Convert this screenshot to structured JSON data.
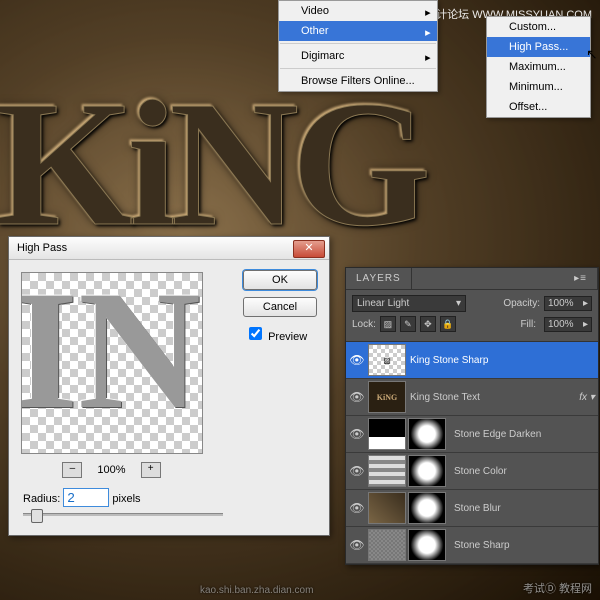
{
  "watermark_text": "思缘设计论坛 WWW.MISSYUAN.COM",
  "bottom_watermark": "考试Ⓓ 教程网",
  "bottom_watermark2": "kao.shi.ban.zha.dian.com",
  "bg_text": "KiNG",
  "menu": {
    "items": [
      {
        "label": "Video",
        "has_sub": true
      },
      {
        "label": "Other",
        "has_sub": true,
        "highlighted": true
      },
      {
        "label": "Digimarc",
        "has_sub": true
      },
      {
        "label": "Browse Filters Online..."
      }
    ]
  },
  "submenu": {
    "items": [
      {
        "label": "Custom..."
      },
      {
        "label": "High Pass...",
        "highlighted": true
      },
      {
        "label": "Maximum..."
      },
      {
        "label": "Minimum..."
      },
      {
        "label": "Offset..."
      }
    ]
  },
  "highpass": {
    "title": "High Pass",
    "ok": "OK",
    "cancel": "Cancel",
    "preview_label": "Preview",
    "preview_checked": true,
    "zoom_label": "100%",
    "zoom_out": "–",
    "zoom_in": "+",
    "radius_label": "Radius:",
    "radius_value": "2",
    "radius_unit": "pixels",
    "preview_text": "IN",
    "close_glyph": "✕"
  },
  "layers": {
    "tab": "LAYERS",
    "collapse": "▸≡",
    "blend_mode": "Linear Light",
    "opacity_label": "Opacity:",
    "opacity_value": "100%",
    "lock_label": "Lock:",
    "fill_label": "Fill:",
    "fill_value": "100%",
    "lock_icons": [
      "▨",
      "✎",
      "✥",
      "🔒"
    ],
    "items": [
      {
        "name": "King Stone Sharp",
        "thumb": "▨",
        "selected": true
      },
      {
        "name": "King Stone Text",
        "thumb": "KiNG",
        "fx": "fx ▾"
      },
      {
        "name": "Stone Edge Darken",
        "thumb": "■",
        "mask": true
      },
      {
        "name": "Stone Color",
        "thumb": "≣",
        "mask": true
      },
      {
        "name": "Stone Blur",
        "thumb": "▦",
        "mask": true
      },
      {
        "name": "Stone Sharp",
        "thumb": "▦",
        "mask": true
      }
    ]
  }
}
